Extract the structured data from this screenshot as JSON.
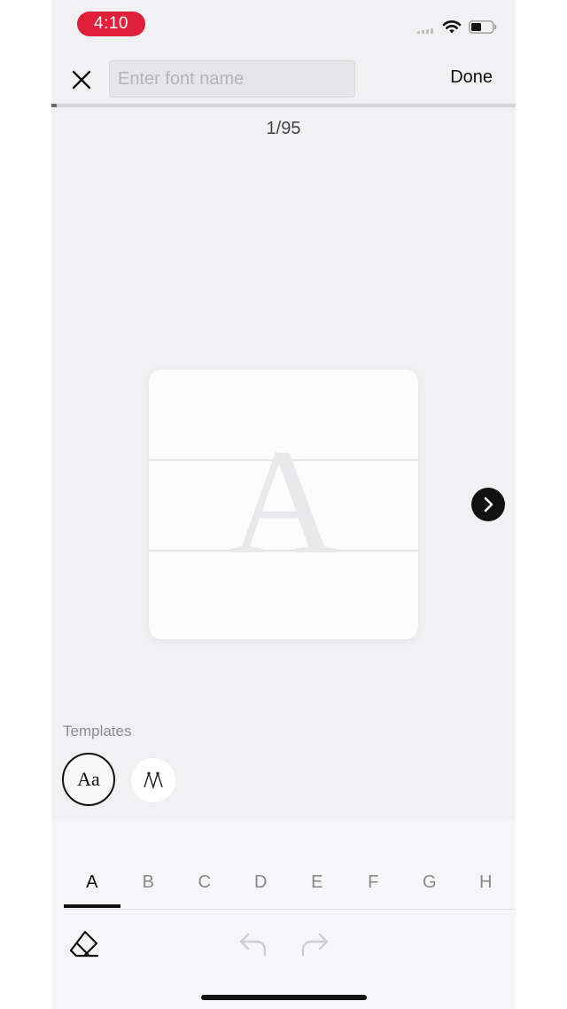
{
  "status_bar": {
    "time": "4:10",
    "icons": [
      "cellular-signal-icon",
      "wifi-icon",
      "battery-icon"
    ]
  },
  "header": {
    "close_icon": "close-icon",
    "font_name": {
      "value": "",
      "placeholder": "Enter font name"
    },
    "done_label": "Done"
  },
  "progress": {
    "current": 1,
    "total": 95,
    "counter_text": "1/95",
    "fraction": 0.0105
  },
  "canvas": {
    "template_glyph": "A",
    "next_icon": "chevron-right-icon"
  },
  "templates": {
    "label": "Templates",
    "options": [
      {
        "label": "Aa",
        "selected": true
      },
      {
        "label": "ꟽ",
        "selected": false
      }
    ]
  },
  "letters": {
    "tabs": [
      "A",
      "B",
      "C",
      "D",
      "E",
      "F",
      "G",
      "H"
    ],
    "active": "A"
  },
  "toolbar": {
    "eraser_icon": "eraser-icon",
    "undo_icon": "undo-icon",
    "redo_icon": "redo-icon"
  },
  "colors": {
    "time_pill": "#e0203a",
    "background": "#f1f0f2",
    "accent": "#111111"
  }
}
